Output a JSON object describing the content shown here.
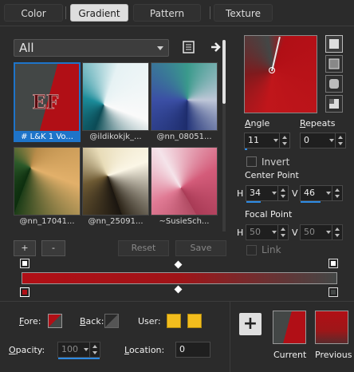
{
  "tabs": [
    {
      "label": "Color"
    },
    {
      "label": "Gradient"
    },
    {
      "label": "Pattern"
    },
    {
      "label": "Texture"
    }
  ],
  "category": {
    "selected": "All"
  },
  "thumbnails": [
    {
      "caption": "# L&K 1 Vo...",
      "logo_text": "EF"
    },
    {
      "caption": "@ildikokjk_..."
    },
    {
      "caption": "@nn_08051..."
    },
    {
      "caption": "@nn_17041..."
    },
    {
      "caption": "@nn_25091..."
    },
    {
      "caption": "~SusieSch..."
    }
  ],
  "angle": {
    "label": "Angle",
    "value": "11"
  },
  "repeats": {
    "label": "Repeats",
    "value": "0"
  },
  "invert": {
    "label": "Invert"
  },
  "center_point": {
    "label": "Center Point",
    "h_label": "H",
    "h": "34",
    "v_label": "V",
    "v": "46"
  },
  "focal_point": {
    "label": "Focal Point",
    "h_label": "H",
    "h": "50",
    "v_label": "V",
    "v": "50"
  },
  "link": {
    "label": "Link"
  },
  "buttons": {
    "add": "+",
    "remove": "-",
    "reset": "Reset",
    "save": "Save"
  },
  "fore": {
    "label": "Fore:"
  },
  "back": {
    "label": "Back:"
  },
  "user": {
    "label": "User:"
  },
  "opacity": {
    "label": "Opacity:",
    "value": "100"
  },
  "location": {
    "label": "Location:",
    "value": "0"
  },
  "current": {
    "label": "Current"
  },
  "previous": {
    "label": "Previous"
  },
  "colors": {
    "gradient_start": "#b10f16",
    "gradient_end": "#434746",
    "user_1": "#f2bd1d",
    "user_2": "#f2bd1d",
    "accent": "#2d8ae3"
  }
}
